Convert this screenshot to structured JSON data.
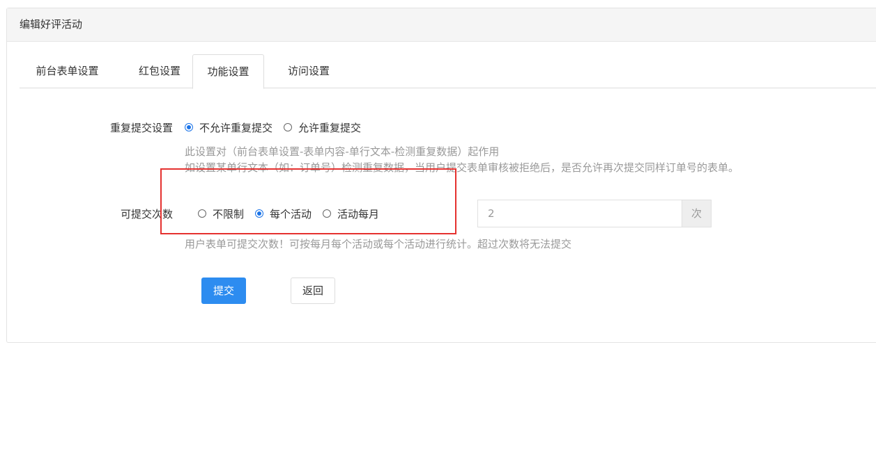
{
  "panel": {
    "title": "编辑好评活动"
  },
  "tabs": [
    {
      "label": "前台表单设置",
      "active": false
    },
    {
      "label": "红包设置",
      "active": false
    },
    {
      "label": "功能设置",
      "active": true
    },
    {
      "label": "访问设置",
      "active": false
    }
  ],
  "repeat_submit": {
    "label": "重复提交设置",
    "options": [
      {
        "label": "不允许重复提交",
        "checked": true
      },
      {
        "label": "允许重复提交",
        "checked": false
      }
    ],
    "help_line1": "此设置对（前台表单设置-表单内容-单行文本-检测重复数据）起作用",
    "help_line2": "如设置某单行文本（如：订单号）检测重复数据，当用户提交表单审核被拒绝后，是否允许再次提交同样订单号的表单。"
  },
  "submit_count": {
    "label": "可提交次数",
    "options": [
      {
        "label": "不限制",
        "checked": false
      },
      {
        "label": "每个活动",
        "checked": true
      },
      {
        "label": "活动每月",
        "checked": false
      }
    ],
    "value": "2",
    "unit": "次",
    "help": "用户表单可提交次数！可按每月每个活动或每个活动进行统计。超过次数将无法提交"
  },
  "actions": {
    "submit_label": "提交",
    "back_label": "返回"
  },
  "colors": {
    "primary": "#2d8cf0",
    "radio_checked": "#1a73e8",
    "highlight_border": "#e5312f"
  }
}
